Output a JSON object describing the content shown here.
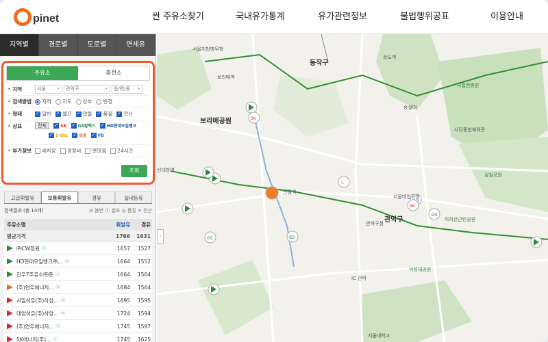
{
  "brand": {
    "logo_text": "pinet",
    "accent": "#f26b1d",
    "green": "#3aa854"
  },
  "topnav": [
    "싼 주유소찾기",
    "국내유가통계",
    "유가관련정보",
    "불법행위공표",
    "이용안내"
  ],
  "region_tabs": [
    "지역별",
    "경로별",
    "도로별",
    "면세유"
  ],
  "station_type": [
    "주유소",
    "충전소"
  ],
  "filters": {
    "region_label": "지역",
    "region_values": [
      "서울",
      "관악구",
      "읍/면/동"
    ],
    "method_label": "검색방법",
    "methods": [
      "지역",
      "지도",
      "상호",
      "반경"
    ],
    "form_label": "형태",
    "forms": [
      "일반",
      "셀프",
      "알뜰",
      "품질",
      "전산"
    ],
    "brand_label": "상표",
    "brand_all": "전체",
    "brands_row1": [
      "SK",
      "GS칼텍스",
      "HD현대오일뱅크"
    ],
    "brands_row2": [
      "S-OIL",
      "알뜰",
      "PB"
    ],
    "extra_label": "부가정보",
    "extras": [
      "세차장",
      "경정비",
      "편의점",
      "24시간"
    ],
    "search_button": "조회"
  },
  "fuel_tabs": [
    "고급휘발유",
    "보통휘발유",
    "경유",
    "실내등유"
  ],
  "result": {
    "text": "검색결과 (총 14개)",
    "legend": "⊘ 불번 ⓢ 셀프 ◎ 품질 ✕ 전산"
  },
  "table": {
    "headers": [
      "주유소명",
      "휘발유",
      "경유"
    ],
    "avg": {
      "name": "평균가격",
      "gas": "1766",
      "diesel": "1631"
    },
    "rows": [
      {
        "name": "㈜CW정원",
        "gas": "1657",
        "diesel": "1527",
        "logo": "#2e8b3a"
      },
      {
        "name": "HD현대오일뱅크㈜...",
        "gas": "1664",
        "diesel": "1552",
        "logo": "#2e8b3a"
      },
      {
        "name": "진우7주유소㈜준",
        "gas": "1664",
        "diesel": "1564",
        "logo": "#2e8b3a"
      },
      {
        "name": "(주)연우에너지...",
        "gas": "1684",
        "diesel": "1564",
        "logo": "#e07820"
      },
      {
        "name": "서일석유(주)삭성...",
        "gas": "1695",
        "diesel": "1595",
        "logo": "#d23"
      },
      {
        "name": "대양석유(주)삭양...",
        "gas": "1724",
        "diesel": "1594",
        "logo": "#d23"
      },
      {
        "name": "(주)연우에너지...",
        "gas": "1745",
        "diesel": "1597",
        "logo": "#d23"
      },
      {
        "name": "SK에너지(주)...",
        "gas": "1745",
        "diesel": "1625",
        "logo": "#d23"
      }
    ]
  },
  "map_labels": {
    "district": "동작구",
    "gwanak": "관악구",
    "boramae": "보라매공원",
    "sindaebang": "신대방역",
    "sillim": "신림역",
    "gwanakgu_office": "관악구청",
    "seoul_univ": "서울대학교",
    "sangdo": "상도역",
    "guro": "보라매역",
    "seongsil": "숭실대",
    "national_cemetery": "국립현충원",
    "seoul_uni_station": "서울대입구역",
    "nakseongdae": "낙성대공원",
    "ic": "IC 관악",
    "yeouido": "서울지방병무청",
    "sadang": "사당종합체육관",
    "kkachi": "까치산근린공원",
    "samil": "삼일공원"
  }
}
